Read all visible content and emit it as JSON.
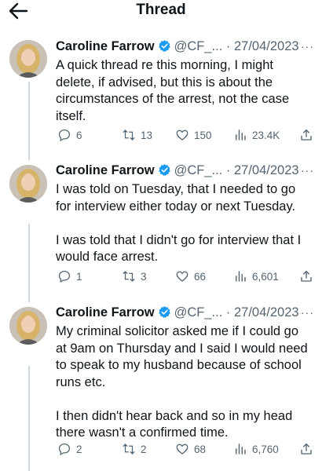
{
  "header": {
    "title": "Thread",
    "back_icon": "arrow-left-icon"
  },
  "tweets": [
    {
      "name": "Caroline Farrow",
      "handle": "@CF_...",
      "sep": "·",
      "date": "27/04/2023",
      "more": "···",
      "text": "A quick thread re this morning, I might\ndelete, if advised, but this is about the\ncircumstances of the arrest, not the case\nitself.",
      "replies": "6",
      "retweets": "13",
      "likes": "150",
      "views": "23.4K"
    },
    {
      "name": "Caroline Farrow",
      "handle": "@CF_...",
      "sep": "·",
      "date": "27/04/2023",
      "more": "···",
      "text": "I was told on Tuesday, that I needed to go\nfor interview either today or next Tuesday.\n\nI was told that I didn't go for interview that I\nwould face arrest.",
      "replies": "1",
      "retweets": "3",
      "likes": "66",
      "views": "6,601"
    },
    {
      "name": "Caroline Farrow",
      "handle": "@CF_...",
      "sep": "·",
      "date": "27/04/2023",
      "more": "···",
      "text": "My criminal solicitor asked me if I could go\nat 9am on Thursday and I said I would need\nto speak to my husband because of school\nruns etc.\n\nI then didn't hear back and so in my head\nthere wasn't a confirmed time.",
      "replies": "2",
      "retweets": "2",
      "likes": "68",
      "views": "6,760"
    }
  ],
  "colors": {
    "verified": "#1d9bf0",
    "secondary_text": "#536471",
    "thread_line": "#cfd9de"
  }
}
